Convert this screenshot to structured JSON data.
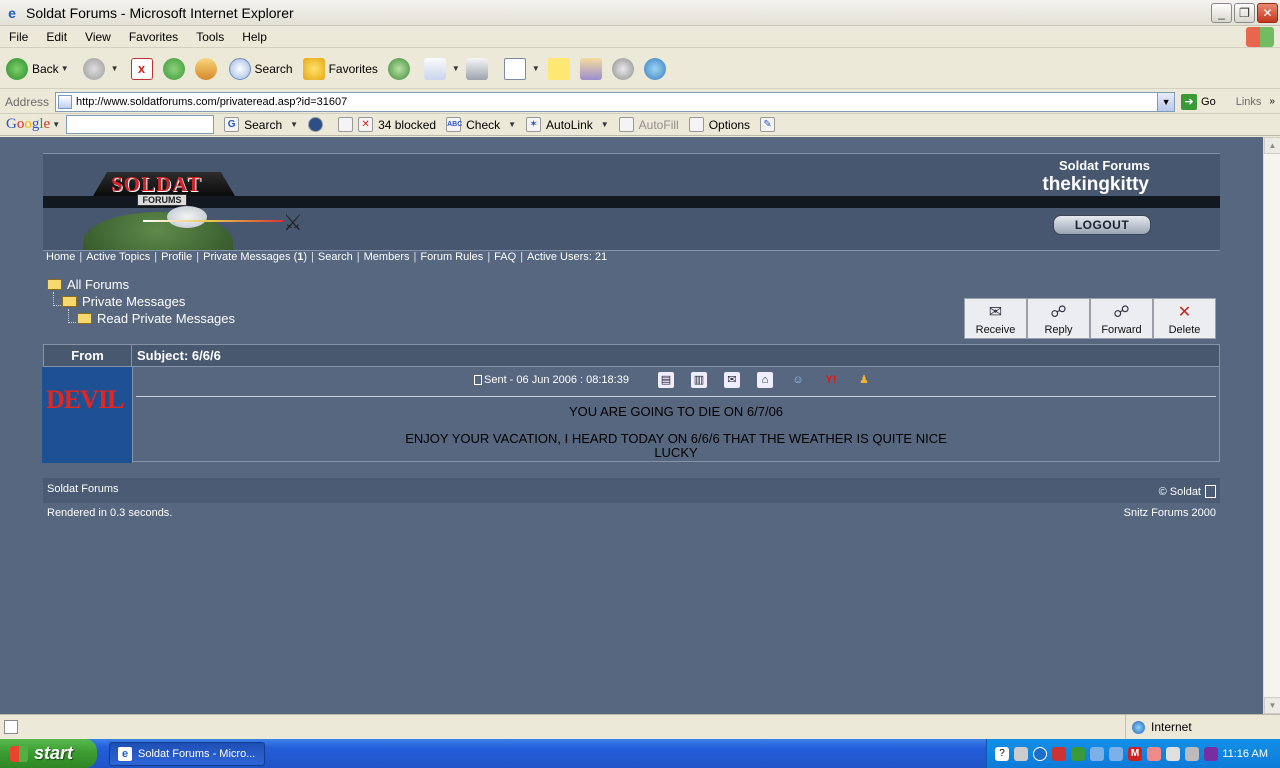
{
  "window": {
    "title": "Soldat Forums - Microsoft Internet Explorer"
  },
  "menu": [
    "File",
    "Edit",
    "View",
    "Favorites",
    "Tools",
    "Help"
  ],
  "toolbar": {
    "back": "Back",
    "search": "Search",
    "favorites": "Favorites"
  },
  "address": {
    "label": "Address",
    "url": "http://www.soldatforums.com/privateread.asp?id=31607",
    "go": "Go",
    "links": "Links"
  },
  "google": {
    "logo": [
      "G",
      "o",
      "o",
      "g",
      "l",
      "e"
    ],
    "search": "Search",
    "blocked": "34 blocked",
    "check": "Check",
    "autolink": "AutoLink",
    "autofill": "AutoFill",
    "options": "Options"
  },
  "forum": {
    "site_name": "Soldat Forums",
    "username": "thekingkitty",
    "logout": "LOGOUT",
    "logo_text": "SOLDAT",
    "logo_sub": "FORUMS",
    "nav": {
      "home": "Home",
      "active_topics": "Active Topics",
      "profile": "Profile",
      "private_messages": "Private Messages (",
      "pm_count": "1",
      "pm_close": ")",
      "search": "Search",
      "members": "Members",
      "rules": "Forum Rules",
      "faq": "FAQ",
      "active_users": "Active Users: 21"
    },
    "breadcrumb": [
      "All Forums",
      "Private Messages",
      "Read Private Messages"
    ],
    "actions": [
      "Receive",
      "Reply",
      "Forward",
      "Delete"
    ],
    "message": {
      "from_label": "From",
      "subject": "Subject:  6/6/6",
      "sender_avatar_text": "DEVIL",
      "sent": "Sent - 06 Jun 2006 :  08:18:39",
      "line1": "YOU ARE GOING TO DIE ON 6/7/06",
      "line2": "ENJOY YOUR VACATION, I HEARD TODAY ON 6/6/6 THAT THE WEATHER IS QUITE NICE",
      "line3": "LUCKY"
    },
    "footer": {
      "left": "Soldat Forums",
      "right": "© Soldat",
      "rendered": "Rendered in 0.3 seconds.",
      "snitz": "Snitz Forums 2000"
    }
  },
  "status": {
    "zone": "Internet"
  },
  "taskbar": {
    "start": "start",
    "task": "Soldat Forums - Micro...",
    "clock": "11:16 AM"
  }
}
